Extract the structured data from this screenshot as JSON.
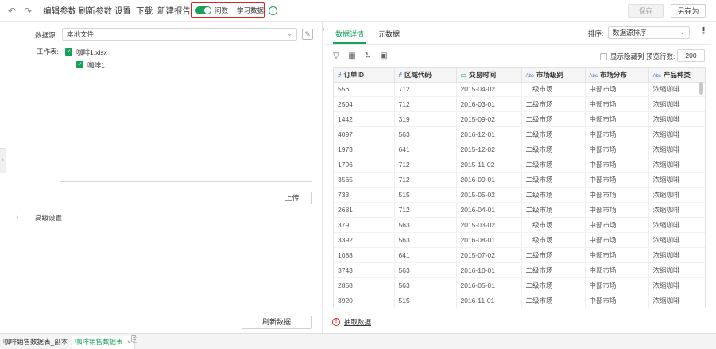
{
  "toolbar": {
    "edit_params": "编辑参数",
    "refresh_params": "刷新参数",
    "settings": "设置",
    "download": "下载",
    "new_report": "新建报告",
    "toggle_ask": "问数",
    "toggle_learn": "学习数据",
    "save": "保存",
    "save_as": "另存为"
  },
  "left": {
    "datasource_label": "数据源:",
    "datasource_value": "本地文件",
    "worksheet_label": "工作表:",
    "tree": {
      "file": "咖啡1.xlsx",
      "sheet": "咖啡1"
    },
    "upload_button": "上传",
    "advanced_settings": "高级设置",
    "refresh_data": "刷新数据"
  },
  "right": {
    "tabs": [
      "数据详情",
      "元数据"
    ],
    "sort_label": "排序:",
    "sort_value": "数据源排序",
    "show_hidden": "显示隐藏列",
    "preview_rows_label": "预览行数:",
    "preview_rows_value": "200",
    "extract_data": "抽取数据"
  },
  "table": {
    "columns": [
      {
        "type": "#",
        "name": "订单ID"
      },
      {
        "type": "#",
        "name": "区域代码"
      },
      {
        "type": "cal",
        "name": "交易时间"
      },
      {
        "type": "Abc",
        "name": "市场级别"
      },
      {
        "type": "Abc",
        "name": "市场分布"
      },
      {
        "type": "Abc",
        "name": "产品种类"
      }
    ],
    "rows": [
      [
        "556",
        "712",
        "2015-04-02",
        "二级市场",
        "中部市场",
        "浓缩咖啡"
      ],
      [
        "2504",
        "712",
        "2016-03-01",
        "二级市场",
        "中部市场",
        "浓缩咖啡"
      ],
      [
        "1442",
        "319",
        "2015-09-02",
        "二级市场",
        "中部市场",
        "浓缩咖啡"
      ],
      [
        "4097",
        "563",
        "2016-12-01",
        "二级市场",
        "中部市场",
        "浓缩咖啡"
      ],
      [
        "1973",
        "641",
        "2015-12-02",
        "二级市场",
        "中部市场",
        "浓缩咖啡"
      ],
      [
        "1796",
        "712",
        "2015-11-02",
        "二级市场",
        "中部市场",
        "浓缩咖啡"
      ],
      [
        "3565",
        "712",
        "2016-09-01",
        "二级市场",
        "中部市场",
        "浓缩咖啡"
      ],
      [
        "733",
        "515",
        "2015-05-02",
        "二级市场",
        "中部市场",
        "浓缩咖啡"
      ],
      [
        "2681",
        "712",
        "2016-04-01",
        "二级市场",
        "中部市场",
        "浓缩咖啡"
      ],
      [
        "379",
        "563",
        "2015-03-02",
        "二级市场",
        "中部市场",
        "浓缩咖啡"
      ],
      [
        "3392",
        "563",
        "2016-08-01",
        "二级市场",
        "中部市场",
        "浓缩咖啡"
      ],
      [
        "1088",
        "641",
        "2015-07-02",
        "二级市场",
        "中部市场",
        "浓缩咖啡"
      ],
      [
        "3743",
        "563",
        "2016-10-01",
        "二级市场",
        "中部市场",
        "浓缩咖啡"
      ],
      [
        "2858",
        "563",
        "2016-05-01",
        "二级市场",
        "中部市场",
        "浓缩咖啡"
      ],
      [
        "3920",
        "515",
        "2016-11-01",
        "二级市场",
        "中部市场",
        "浓缩咖啡"
      ]
    ]
  },
  "bottom_tabs": [
    "咖啡销售数据表_副本",
    "咖啡销售数据表"
  ],
  "colors": {
    "accent": "#19a05a",
    "highlight_box": "#d9251c",
    "alert": "#d9251c"
  }
}
